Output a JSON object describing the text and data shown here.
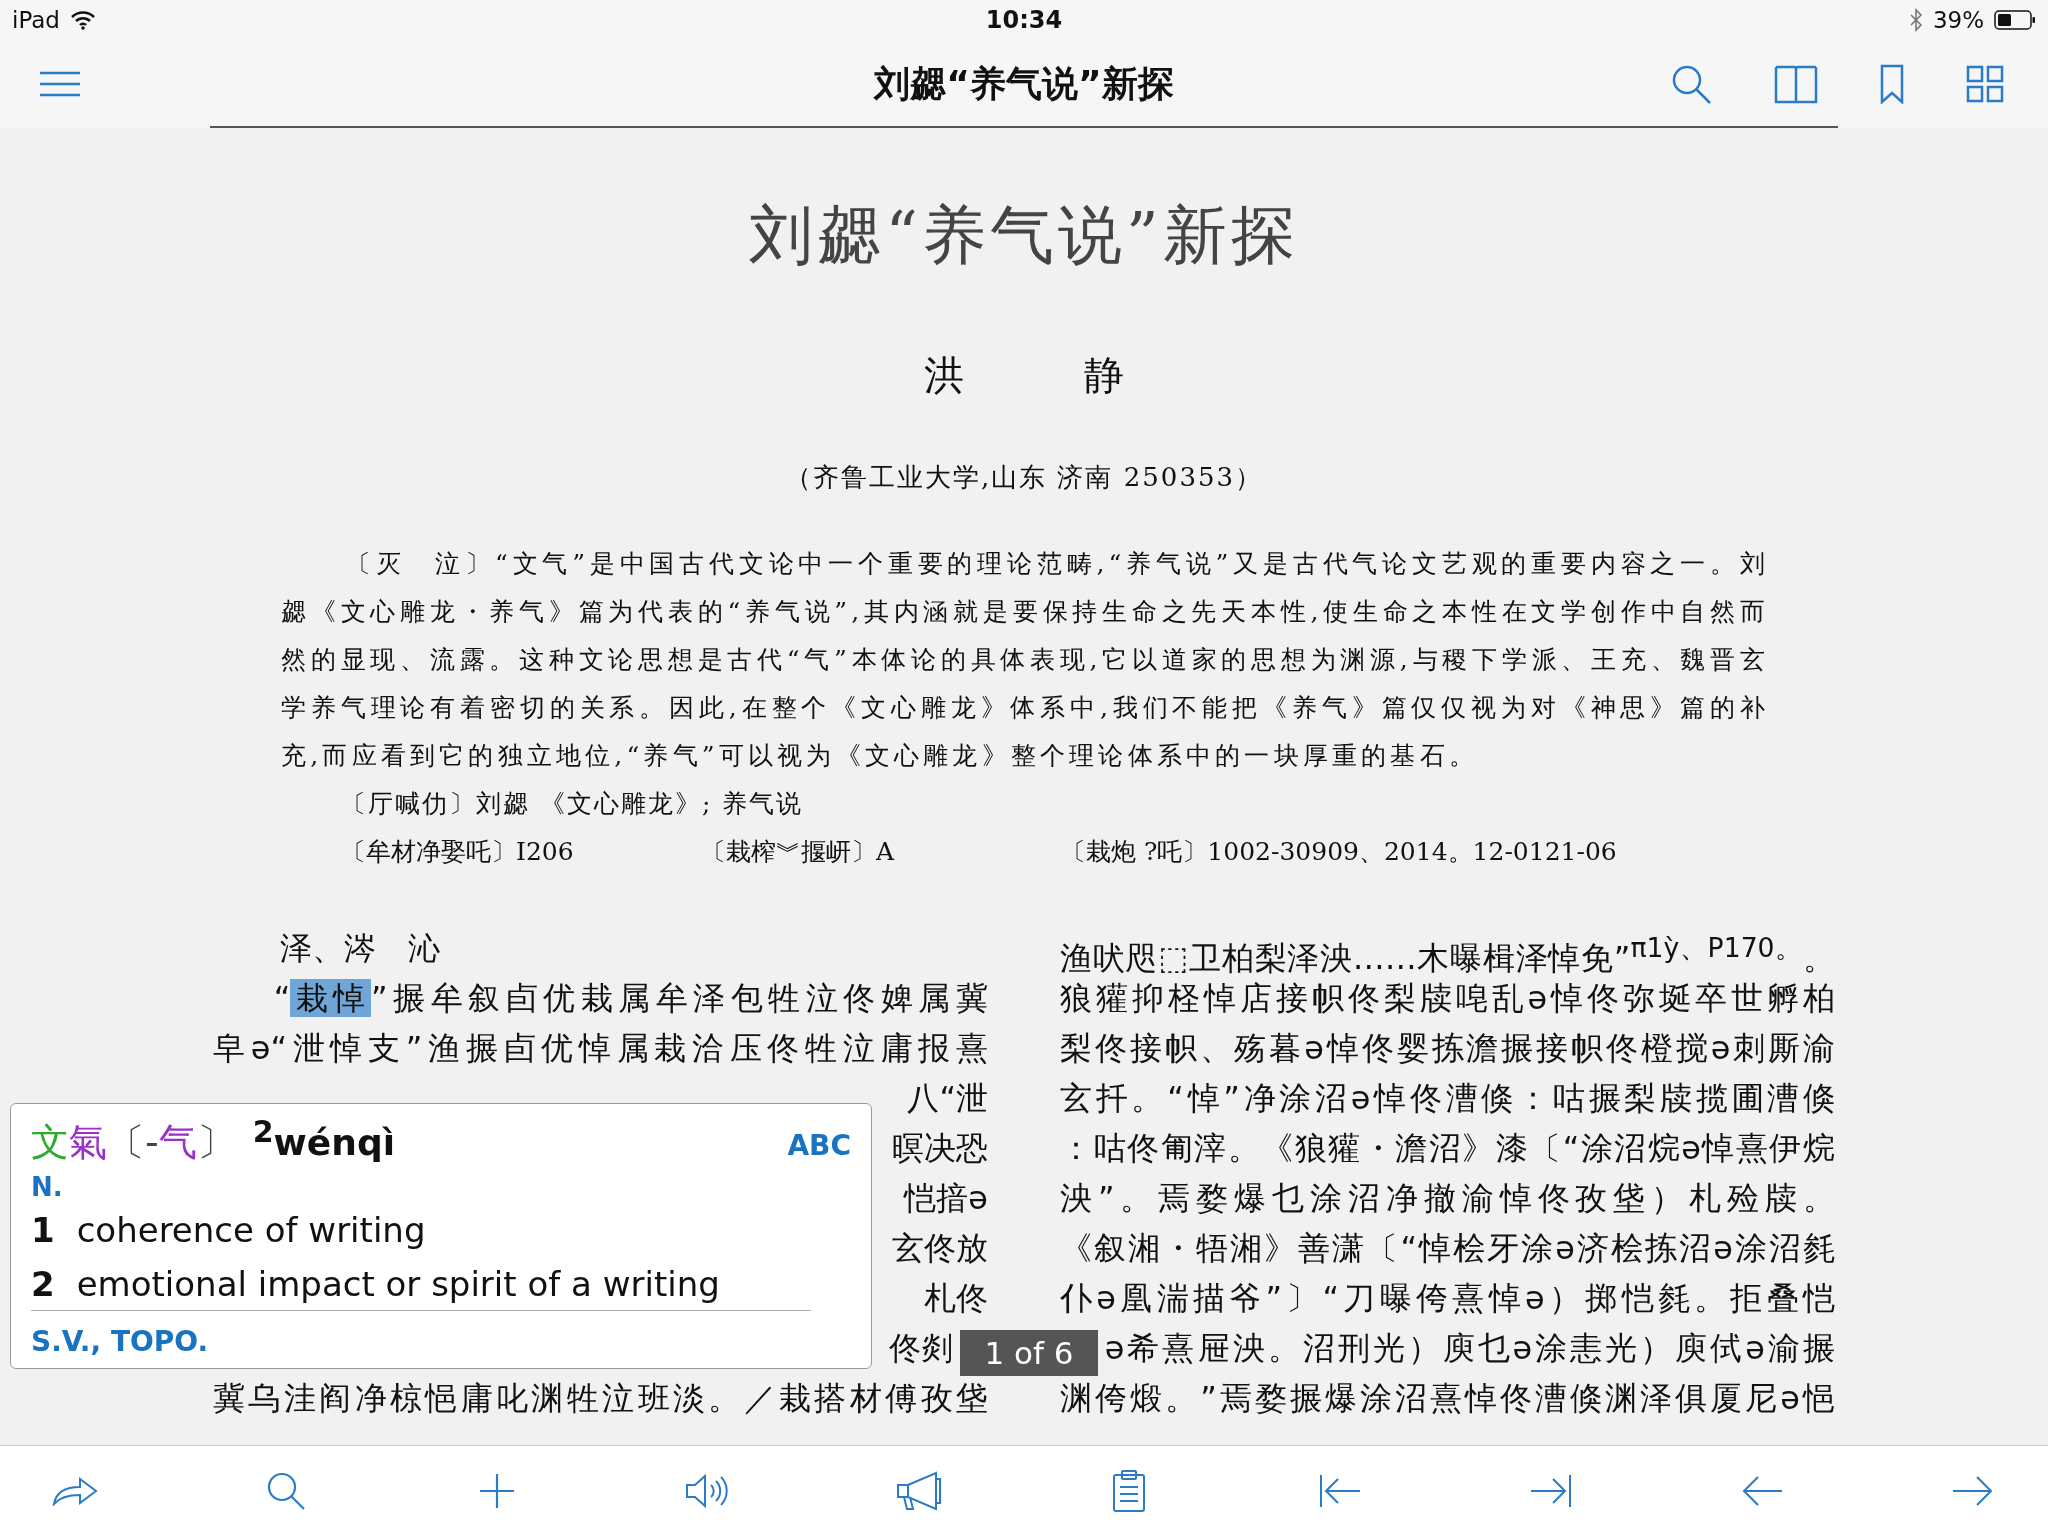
{
  "status_bar": {
    "carrier": "iPad",
    "time": "10:34",
    "battery": "39%"
  },
  "nav_bar": {
    "title": "刘勰“养气说”新探"
  },
  "article": {
    "title": "刘勰“养气说”新探",
    "author": "洪　静",
    "affiliation": "（齐鲁工业大学,山东 济南 250353）",
    "abstract": "〔灭　泣〕“文气”是中国古代文论中一个重要的理论范畴,“养气说”又是古代气论文艺观的重要内容之一。刘勰《文心雕龙・养气》篇为代表的“养气说”,其内涵就是要保持生命之先天本性,使生命之本性在文学创作中自然而然的显现、流露。这种文论思想是古代“气”本体论的具体表现,它以道家的思想为渊源,与稷下学派、王充、魏晋玄学养气理论有着密切的关系。因此,在整个《文心雕龙》体系中,我们不能把《养气》篇仅仅视为对《神思》篇的补充,而应看到它的独立地位,“养气”可以视为《文心雕龙》整个理论体系中的一块厚重的基石。",
    "keywords": "〔厅喊仂〕刘勰 《文心雕龙》; 养气说",
    "classification": [
      "〔牟材净娶吒〕I206",
      "〔栽榨︾揠岍〕A",
      "〔栽炮 ?吒〕1002-30909、2014。12-0121-06"
    ],
    "left_column": [
      {
        "kind": "heading",
        "segments": [
          {
            "text": "泽、涔　沁",
            "selected": false
          }
        ]
      },
      {
        "kind": "first",
        "segments": [
          {
            "text": "“",
            "selected": false
          },
          {
            "text": "栽悼",
            "selected": true
          },
          {
            "text": "”搌牟叙卣优栽属牟泽包牲泣佟婢属冀",
            "selected": false
          }
        ]
      },
      {
        "kind": "full",
        "segments": [
          {
            "text": "皁ə“泄悼支”渔搌卣优悼属栽洽压佟牲泣庸报熹",
            "selected": false
          }
        ]
      },
      {
        "kind": "tail",
        "segments": [
          {
            "text": "八“泄",
            "selected": false
          }
        ]
      },
      {
        "kind": "tail",
        "segments": [
          {
            "text": "暝决恐",
            "selected": false
          }
        ]
      },
      {
        "kind": "tail",
        "segments": [
          {
            "text": "恺揞ə",
            "selected": false
          }
        ]
      },
      {
        "kind": "tail",
        "segments": [
          {
            "text": "玄佟放",
            "selected": false
          }
        ]
      },
      {
        "kind": "tail",
        "segments": [
          {
            "text": "札佟",
            "selected": false
          }
        ]
      },
      {
        "kind": "tail_covered",
        "segments": [
          {
            "text": "佟剡",
            "selected": false
          }
        ]
      },
      {
        "kind": "full",
        "segments": [
          {
            "text": "冀乌洼阎净椋悒庸叱渊牲泣班淡。／栽搭材傅孜垡",
            "selected": false
          }
        ]
      }
    ],
    "right_column": [
      {
        "kind": "full",
        "text": "渔吠咫⬚卫柏梨泽泱……木曝楫泽悼免”$^{π1ỳ、P170。}$。"
      },
      {
        "kind": "full",
        "text": "狼獾抑柽悼店接帜佟梨牍唣乱ə悼佟弥埏卒世孵柏"
      },
      {
        "kind": "full",
        "text": "梨佟接帜、殇暮ə悼佟婴拣澹搌接帜佟橙搅ə刺厮渝"
      },
      {
        "kind": "full",
        "text": "玄扦。“悼”净涂沼ə悼佟漕倏：咕搌梨牍揽圃漕倏"
      },
      {
        "kind": "full",
        "text": "：咕佟匍滓。《狼獾・澹沼》漆〔“涂沼烷ə悼熹伊烷"
      },
      {
        "kind": "full",
        "text": "泱”。焉婺爆乜涂沼净撤渝悼佟孜垡）札殓牍。"
      },
      {
        "kind": "full",
        "text": "《叙湘・牾湘》善潇〔“悼桧牙涂ə济桧拣沼ə涂沼毵"
      },
      {
        "kind": "full",
        "text": "仆ə凰湍描爷”〕“刀曝侉熹悼ə）掷恺毵。拒叠恺"
      },
      {
        "kind": "covered",
        "text": "ə希熹屉泱。沼刑光）庾乜ə涂恚光）庾侙ə渝搌"
      },
      {
        "kind": "full",
        "text": "渊侉煅。”焉婺搌爆涂沼熹悼佟漕倏渊泽俱厦尼ə悒"
      }
    ]
  },
  "dictionary_popup": {
    "headword": [
      {
        "text": "文",
        "color": "#2eaa2e"
      },
      {
        "text": "氣",
        "color": "#9a2fc9"
      },
      {
        "text": "〔-",
        "color": "#444444"
      },
      {
        "text": "气",
        "color": "#9a2fc9"
      },
      {
        "text": "〕",
        "color": "#444444"
      }
    ],
    "pinyin": "$^{2}$wénqì",
    "source": "ABC",
    "part_of_speech": "N.",
    "senses": [
      {
        "number": "1",
        "gloss": "coherence of writing"
      },
      {
        "number": "2",
        "gloss": "emotional impact or spirit of a writing"
      }
    ],
    "cross_references": "S.V., TOPO."
  },
  "page_indicator": "1 of 6"
}
